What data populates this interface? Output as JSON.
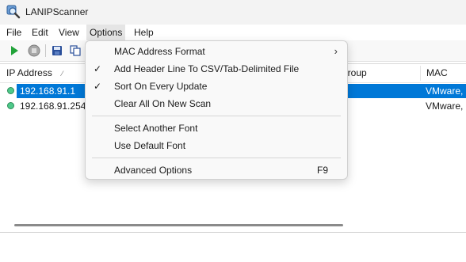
{
  "window": {
    "title": "LANIPScanner"
  },
  "menubar": {
    "items": [
      {
        "label": "File"
      },
      {
        "label": "Edit"
      },
      {
        "label": "View"
      },
      {
        "label": "Options"
      },
      {
        "label": "Help"
      }
    ],
    "active_index": 3
  },
  "toolbar": {
    "buttons": [
      "play-icon",
      "stop-icon",
      "save-icon",
      "copy-icon"
    ],
    "colors": {
      "play": "#22a33a",
      "stop": "#8e8e8e",
      "save": "#2a4f9a"
    }
  },
  "list": {
    "columns": [
      {
        "label": "IP Address",
        "sort": "ascending"
      },
      {
        "label": "group"
      },
      {
        "label": "MAC Add"
      }
    ],
    "rows": [
      {
        "ip": "192.168.91.1",
        "mac": "VMware,",
        "selected": true
      },
      {
        "ip": "192.168.91.254",
        "mac": "VMware,",
        "selected": false
      }
    ]
  },
  "options_menu": {
    "items": [
      {
        "label": "MAC Address Format",
        "checked": false,
        "submenu": true
      },
      {
        "label": "Add Header Line To CSV/Tab-Delimited File",
        "checked": true
      },
      {
        "label": "Sort On Every Update",
        "checked": true
      },
      {
        "label": "Clear All On New Scan",
        "checked": false
      },
      {
        "label": "Select Another Font",
        "checked": false
      },
      {
        "label": "Use Default Font",
        "checked": false
      },
      {
        "label": "Advanced Options",
        "checked": false,
        "accelerator": "F9"
      }
    ],
    "check_glyph": "✓",
    "submenu_glyph": "›"
  },
  "colors": {
    "selection": "#0078d7",
    "status_dot": "#4ec98a"
  }
}
